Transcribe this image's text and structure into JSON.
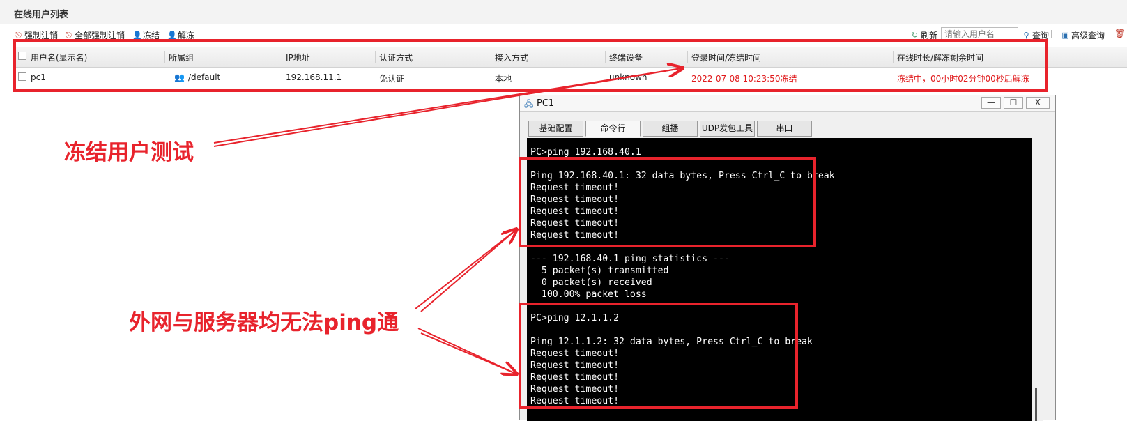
{
  "panel": {
    "title": "在线用户列表"
  },
  "toolbar": {
    "force_logout": "强制注销",
    "force_logout_all": "全部强制注销",
    "freeze": "冻结",
    "unfreeze": "解冻",
    "refresh": "刷新",
    "search_placeholder": "请输入用户名",
    "query": "查询",
    "advanced_query": "高级查询"
  },
  "table": {
    "columns": [
      "用户名(显示名)",
      "所属组",
      "IP地址",
      "认证方式",
      "接入方式",
      "终端设备",
      "登录时间/冻结时间",
      "在线时长/解冻剩余时间"
    ],
    "rows": [
      {
        "username": "pc1",
        "group": "/default",
        "ip": "192.168.11.1",
        "auth": "免认证",
        "access": "本地",
        "device": "unknown",
        "login_time": "2022-07-08 10:23:50冻结",
        "duration": "冻结中，00小时02分钟00秒后解冻"
      }
    ]
  },
  "annotations": {
    "freeze_test": "冻结用户测试",
    "ping_fail": "外网与服务器均无法ping通"
  },
  "pc_window": {
    "title": "PC1",
    "buttons": [
      "—",
      "☐",
      "X"
    ],
    "tabs": [
      "基础配置",
      "命令行",
      "组播",
      "UDP发包工具",
      "串口"
    ],
    "active_tab": "命令行",
    "console_lines": [
      "PC>ping 192.168.40.1",
      "",
      "Ping 192.168.40.1: 32 data bytes, Press Ctrl_C to break",
      "Request timeout!",
      "Request timeout!",
      "Request timeout!",
      "Request timeout!",
      "Request timeout!",
      "",
      "--- 192.168.40.1 ping statistics ---",
      "  5 packet(s) transmitted",
      "  0 packet(s) received",
      "  100.00% packet loss",
      "",
      "PC>ping 12.1.1.2",
      "",
      "Ping 12.1.1.2: 32 data bytes, Press Ctrl_C to break",
      "Request timeout!",
      "Request timeout!",
      "Request timeout!",
      "Request timeout!",
      "Request timeout!"
    ]
  },
  "colors": {
    "highlight": "#e8232c",
    "frozen_text": "#e0191b",
    "console_bg": "#000000"
  }
}
